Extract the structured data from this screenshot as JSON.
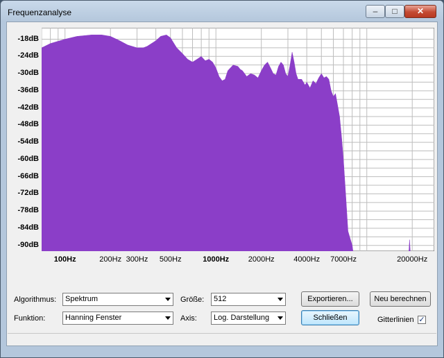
{
  "window": {
    "title": "Frequenzanalyse",
    "min_glyph": "–",
    "max_glyph": "□",
    "close_glyph": "✕"
  },
  "colors": {
    "spectrum": "#8b3ec8",
    "grid": "#bdbdbd",
    "plot_bg": "#ffffff"
  },
  "chart_data": {
    "type": "area",
    "title": "",
    "xlabel": "",
    "ylabel": "",
    "x_scale": "log",
    "xlim": [
      70,
      28000
    ],
    "ylim": [
      -92,
      -14
    ],
    "grid": true,
    "y_ticks": [
      "-18dB",
      "-24dB",
      "-30dB",
      "-36dB",
      "-42dB",
      "-48dB",
      "-54dB",
      "-60dB",
      "-66dB",
      "-72dB",
      "-78dB",
      "-84dB",
      "-90dB"
    ],
    "x_ticks": [
      {
        "value": 100,
        "label": "100Hz",
        "bold": true
      },
      {
        "value": 200,
        "label": "200Hz",
        "bold": false
      },
      {
        "value": 300,
        "label": "300Hz",
        "bold": false
      },
      {
        "value": 500,
        "label": "500Hz",
        "bold": false
      },
      {
        "value": 1000,
        "label": "1000Hz",
        "bold": true
      },
      {
        "value": 2000,
        "label": "2000Hz",
        "bold": false
      },
      {
        "value": 4000,
        "label": "4000Hz",
        "bold": false
      },
      {
        "value": 7000,
        "label": "7000Hz",
        "bold": false
      },
      {
        "value": 20000,
        "label": "20000Hz",
        "bold": false
      }
    ],
    "series": [
      {
        "x": [
          70,
          80,
          100,
          120,
          150,
          175,
          200,
          230,
          260,
          300,
          330,
          350,
          400,
          430,
          470,
          500,
          550,
          600,
          650,
          700,
          750,
          800,
          850,
          900,
          950,
          1000,
          1050,
          1100,
          1150,
          1200,
          1300,
          1400,
          1450,
          1500,
          1550,
          1600,
          1700,
          1800,
          1900,
          2000,
          2100,
          2200,
          2300,
          2400,
          2500,
          2600,
          2700,
          2800,
          2900,
          3000,
          3100,
          3200,
          3300,
          3400,
          3500,
          3700,
          3900,
          4000,
          4200,
          4400,
          4600,
          4800,
          5000,
          5200,
          5400,
          5600,
          5800,
          6000,
          6200,
          6400,
          6600,
          6800,
          7000,
          7200,
          7400,
          7500,
          7700,
          7900,
          8000,
          8100
        ],
        "y": [
          -21,
          -19.5,
          -18,
          -17,
          -16.5,
          -16.5,
          -17,
          -18.5,
          -20,
          -21,
          -21,
          -20.5,
          -18.5,
          -17,
          -16.5,
          -17.5,
          -21,
          -23,
          -25,
          -26,
          -25,
          -24,
          -25.5,
          -25,
          -26,
          -28,
          -31,
          -32.5,
          -32,
          -29,
          -27,
          -27.5,
          -28.5,
          -29,
          -30,
          -31,
          -30,
          -30.5,
          -31.5,
          -29,
          -27,
          -26,
          -28,
          -30,
          -30.5,
          -27.5,
          -26,
          -27,
          -30,
          -31,
          -27,
          -22.5,
          -26,
          -30,
          -32,
          -32,
          -34,
          -33,
          -35,
          -32.5,
          -33.5,
          -31.5,
          -30,
          -31.5,
          -31,
          -32,
          -36,
          -38,
          -37,
          -41,
          -45,
          -52,
          -60,
          -70,
          -80,
          -85,
          -87,
          -89,
          -90,
          -92
        ]
      },
      {
        "x": [
          19000,
          19200,
          19400
        ],
        "y": [
          -92,
          -88,
          -92
        ]
      }
    ]
  },
  "controls": {
    "algorithm": {
      "label": "Algorithmus:",
      "value": "Spektrum"
    },
    "size": {
      "label": "Größe:",
      "value": "512"
    },
    "function": {
      "label": "Funktion:",
      "value": "Hanning Fenster"
    },
    "axis": {
      "label": "Axis:",
      "value": "Log. Darstellung"
    },
    "export_button": "Exportieren...",
    "recalc_button": "Neu berechnen",
    "close_button": "Schließen",
    "gridlines": {
      "label": "Gitterlinien",
      "checked": true,
      "check_glyph": "✓"
    }
  }
}
